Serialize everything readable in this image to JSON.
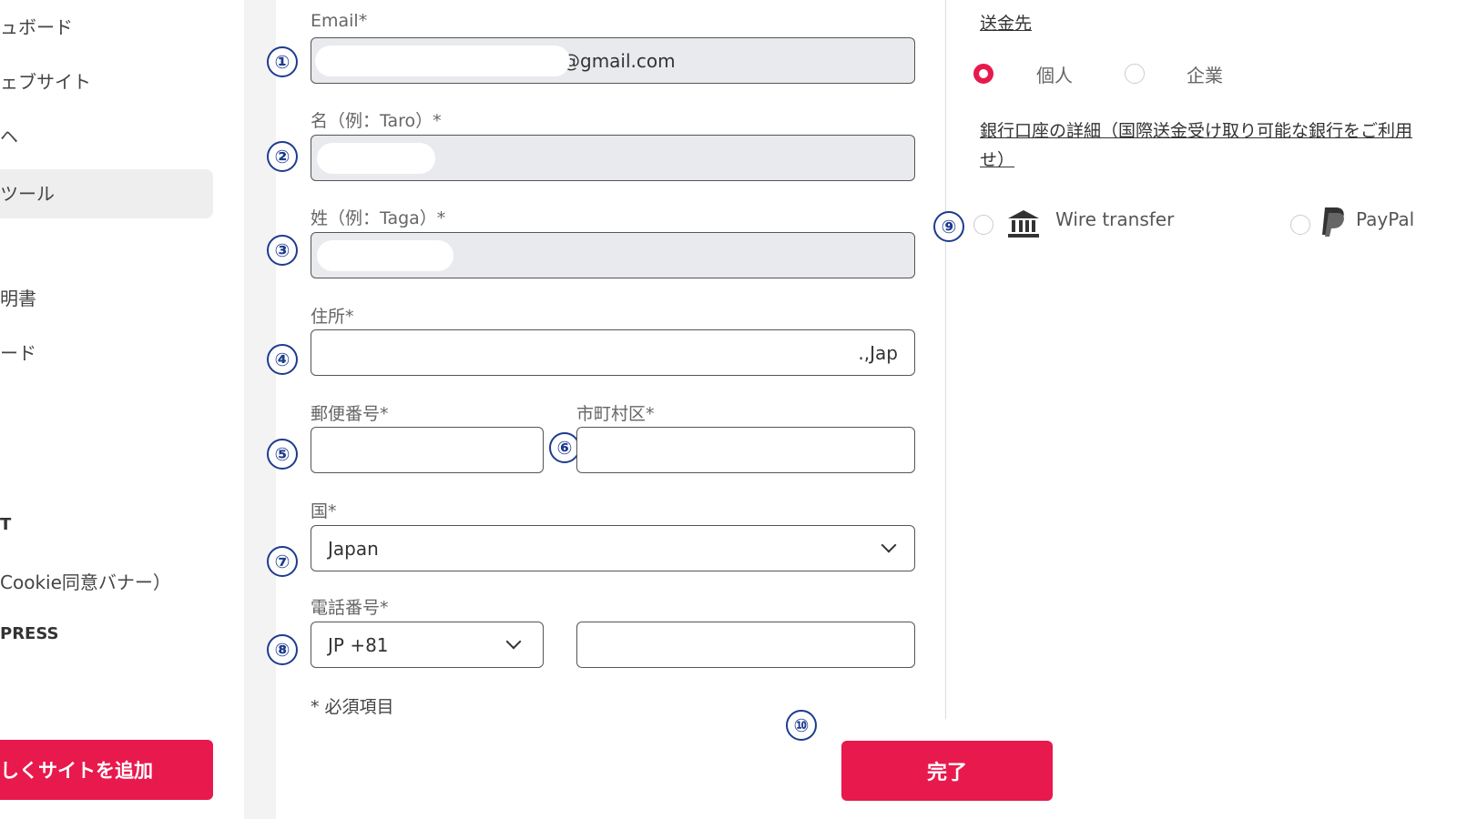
{
  "sidebar": {
    "items": [
      {
        "label": "ュボード"
      },
      {
        "label": "ェブサイト"
      },
      {
        "label": "ヘ"
      },
      {
        "label": "ツール"
      },
      {
        "label": "明書"
      },
      {
        "label": "ード"
      },
      {
        "label": "T"
      },
      {
        "label": "Cookie同意バナー）"
      },
      {
        "label": "PRESS"
      }
    ],
    "add_site_label": "しくサイトを追加"
  },
  "form": {
    "email": {
      "label": "Email*",
      "value": "@gmail.com",
      "marker": "①"
    },
    "first_name": {
      "label": "名（例：Taro）*",
      "marker": "②"
    },
    "last_name": {
      "label": "姓（例：Taga）*",
      "marker": "③"
    },
    "address": {
      "label": "住所*",
      "value": ".,Jap",
      "marker": "④"
    },
    "postal_code": {
      "label": "郵便番号*",
      "marker": "⑤"
    },
    "city": {
      "label": "市町村区*",
      "marker": "⑥"
    },
    "country": {
      "label": "国*",
      "value": "Japan",
      "marker": "⑦"
    },
    "phone": {
      "label": "電話番号*",
      "country_code": "JP +81",
      "marker": "⑧"
    },
    "required_note": "* 必須項目"
  },
  "recipient": {
    "title": "送金先",
    "options": [
      {
        "label": "個人",
        "selected": true
      },
      {
        "label": "企業",
        "selected": false
      }
    ]
  },
  "bank": {
    "title": "銀行口座の詳細（国際送金受け取り可能な銀行をご利用",
    "title_cont": "せ）",
    "marker": "⑨",
    "methods": [
      {
        "label": "Wire transfer",
        "icon": "bank-icon"
      },
      {
        "label": "PayPal",
        "icon": "paypal-icon"
      }
    ]
  },
  "submit": {
    "label": "完了",
    "marker": "⑩"
  },
  "colors": {
    "accent": "#e8194c",
    "marker": "#1d3c8f"
  }
}
